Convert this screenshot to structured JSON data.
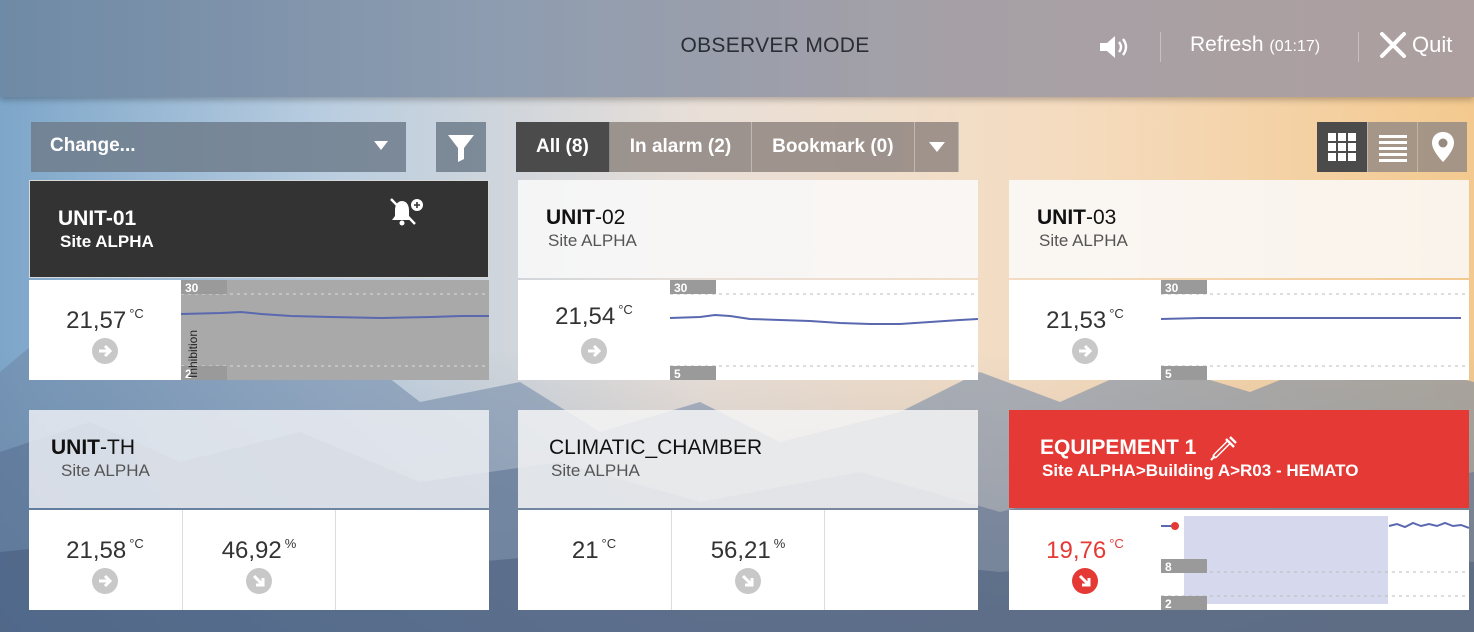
{
  "topbar": {
    "title": "OBSERVER MODE",
    "refresh_label": "Refresh",
    "refresh_countdown": "(01:17)",
    "quit_label": "Quit",
    "sound_icon": "speaker-icon"
  },
  "toolbar": {
    "change_label": "Change...",
    "filter_icon": "filter-icon",
    "tabs": [
      {
        "label": "All (8)",
        "active": true
      },
      {
        "label": "In alarm (2)",
        "active": false
      },
      {
        "label": "Bookmark (0)",
        "active": false
      }
    ],
    "views": [
      "grid-view-icon",
      "list-view-icon",
      "map-pin-icon"
    ]
  },
  "cards": [
    {
      "name_bold": "UNIT-01",
      "name_rest": "",
      "site": "Site ALPHA",
      "style": "dark",
      "icon": "bell-muted-icon",
      "values": [
        {
          "num": "21,57",
          "unit": "°C",
          "trend": "right"
        }
      ],
      "chart": {
        "top_tick": "30",
        "bottom_tick": "2",
        "overlay_label": "Inhibition",
        "shaded": true
      }
    },
    {
      "name_bold": "UNIT",
      "name_rest": "-02",
      "site": "Site ALPHA",
      "style": "light",
      "values": [
        {
          "num": "21,54",
          "unit": "°C",
          "trend": "right"
        }
      ],
      "chart": {
        "top_tick": "30",
        "bottom_tick": "5"
      }
    },
    {
      "name_bold": "UNIT",
      "name_rest": "-03",
      "site": "Site ALPHA",
      "style": "light",
      "values": [
        {
          "num": "21,53",
          "unit": "°C",
          "trend": "right"
        }
      ],
      "chart": {
        "top_tick": "30",
        "bottom_tick": "5"
      }
    },
    {
      "name_bold": "UNIT",
      "name_rest": "-TH",
      "site": "Site ALPHA",
      "style": "light",
      "values": [
        {
          "num": "21,58",
          "unit": "°C",
          "trend": "right"
        },
        {
          "num": "46,92",
          "unit": "%",
          "trend": "down-right"
        }
      ]
    },
    {
      "name_bold": "",
      "name_rest": "CLIMATIC_CHAMBER",
      "site": "Site ALPHA",
      "style": "light",
      "values": [
        {
          "num": "21",
          "unit": "°C",
          "trend": ""
        },
        {
          "num": "56,21",
          "unit": "%",
          "trend": "down-right"
        }
      ]
    },
    {
      "name_bold": "EQUIPEMENT 1",
      "name_rest": "",
      "site": "Site ALPHA>Building A>R03 - HEMATO",
      "style": "red",
      "icon": "syringe-icon",
      "values": [
        {
          "num": "19,76",
          "unit": "°C",
          "trend": "down-right",
          "alarm": true
        }
      ],
      "chart": {
        "top_tick": "8",
        "bottom_tick": "2"
      }
    }
  ]
}
